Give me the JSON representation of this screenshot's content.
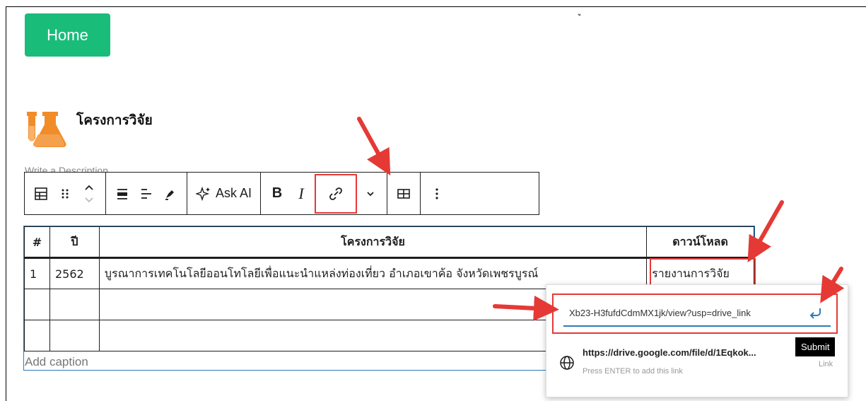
{
  "header": {
    "home_label": "Home",
    "top_glyph": "ู"
  },
  "block": {
    "title": "โครงการวิจัย",
    "description_placeholder": "Write a Description"
  },
  "toolbar": {
    "ask_ai_label": "Ask AI",
    "bold_label": "B",
    "italic_label": "I"
  },
  "table": {
    "headers": [
      "#",
      "ปี",
      "โครงการวิจัย",
      "ดาวน์โหลด"
    ],
    "rows": [
      [
        "1",
        "2562",
        "บูรณาการเทคโนโลยีออนโทโลยีเพื่อแนะนำแหล่งท่องเที่ยว อำเภอเขาค้อ จังหวัดเพชรบูรณ์",
        "รายงานการวิจัย"
      ],
      [
        "",
        "",
        "",
        ""
      ],
      [
        "",
        "",
        "",
        ""
      ]
    ],
    "caption_placeholder": "Add caption"
  },
  "link_popover": {
    "input_value": "Xb23-H3fufdCdmMX1jk/view?usp=drive_link",
    "suggestion_url": "https://drive.google.com/file/d/1Eqkok...",
    "suggestion_hint": "Press ENTER to add this link",
    "submit_tooltip": "Submit",
    "link_label": "Link"
  },
  "colors": {
    "home_bg": "#1abc7a",
    "highlight": "#e53935",
    "focus": "#2b7bb9",
    "icon_orange": "#f28c28"
  }
}
